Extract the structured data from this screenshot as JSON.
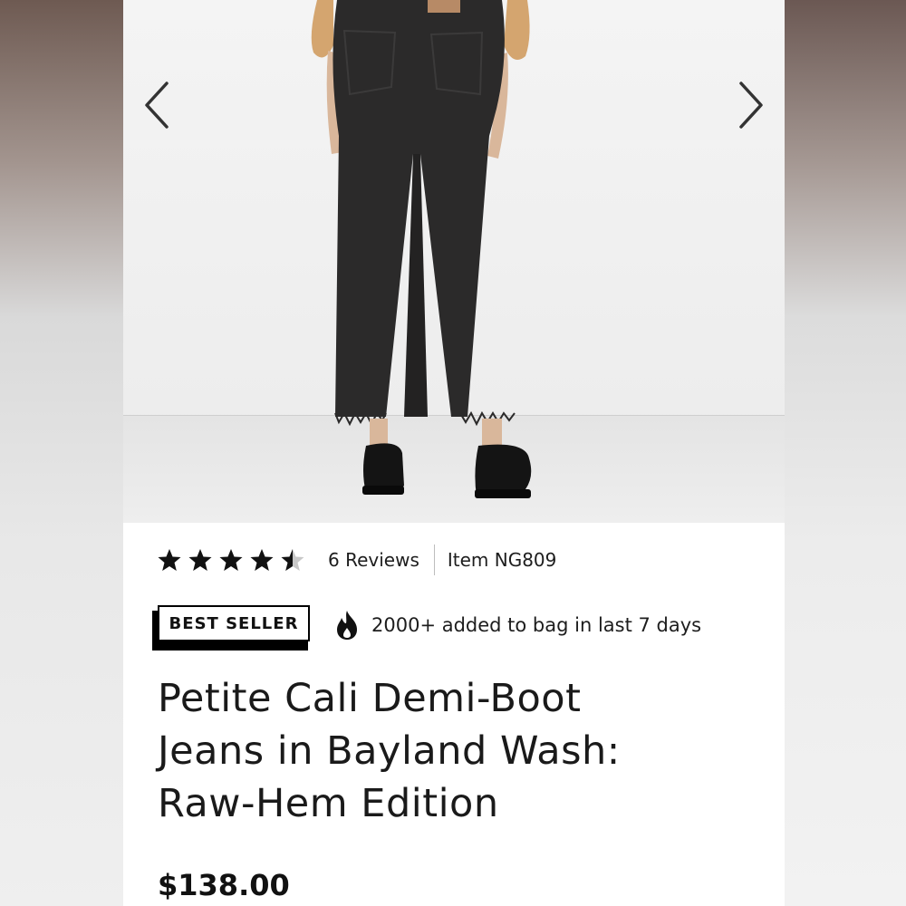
{
  "product": {
    "image_alt": "Black demi-boot jeans with raw hem, rear view, worn with black loafers",
    "rating": 4.5,
    "rating_max": 5,
    "reviews_label": "6 Reviews",
    "item_label": "Item NG809",
    "badge": "BEST SELLER",
    "activity": "2000+ added to bag in last 7 days",
    "title_lines": [
      "Petite Cali Demi-Boot",
      "Jeans in Bayland Wash:",
      "Raw-Hem Edition"
    ],
    "price": "$138.00"
  },
  "carousel": {
    "prev_icon": "chevron-left-icon",
    "next_icon": "chevron-right-icon"
  },
  "icons": {
    "star": "star-icon",
    "flame": "flame-icon"
  },
  "colors": {
    "text": "#1d1d1d",
    "jeans": "#2b2a2a",
    "sweater": "#d4a56f"
  }
}
